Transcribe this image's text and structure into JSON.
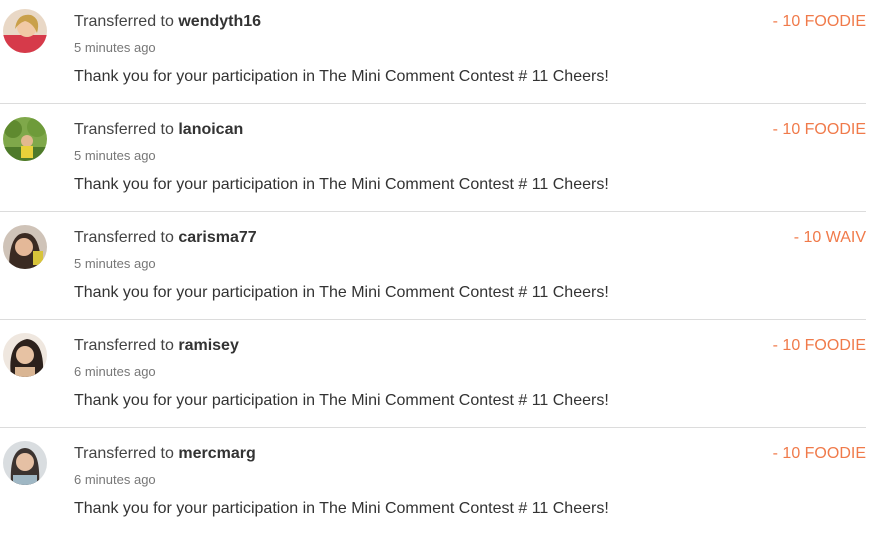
{
  "accent_color": "#f07a4a",
  "transfers": [
    {
      "prefix": "Transferred to ",
      "user": "wendyth16",
      "time": "5 minutes ago",
      "memo": "Thank you for your participation in The Mini Comment Contest # 11 Cheers!",
      "amount": "- 10 FOODIE",
      "avatar": "user-avatar-icon"
    },
    {
      "prefix": "Transferred to ",
      "user": "lanoican",
      "time": "5 minutes ago",
      "memo": "Thank you for your participation in The Mini Comment Contest # 11 Cheers!",
      "amount": "- 10 FOODIE",
      "avatar": "user-avatar-icon"
    },
    {
      "prefix": "Transferred to ",
      "user": "carisma77",
      "time": "5 minutes ago",
      "memo": "Thank you for your participation in The Mini Comment Contest # 11 Cheers!",
      "amount": "- 10 WAIV",
      "avatar": "user-avatar-icon"
    },
    {
      "prefix": "Transferred to ",
      "user": "ramisey",
      "time": "6 minutes ago",
      "memo": "Thank you for your participation in The Mini Comment Contest # 11 Cheers!",
      "amount": "- 10 FOODIE",
      "avatar": "user-avatar-icon"
    },
    {
      "prefix": "Transferred to ",
      "user": "mercmarg",
      "time": "6 minutes ago",
      "memo": "Thank you for your participation in The Mini Comment Contest # 11 Cheers!",
      "amount": "- 10 FOODIE",
      "avatar": "user-avatar-icon"
    }
  ]
}
